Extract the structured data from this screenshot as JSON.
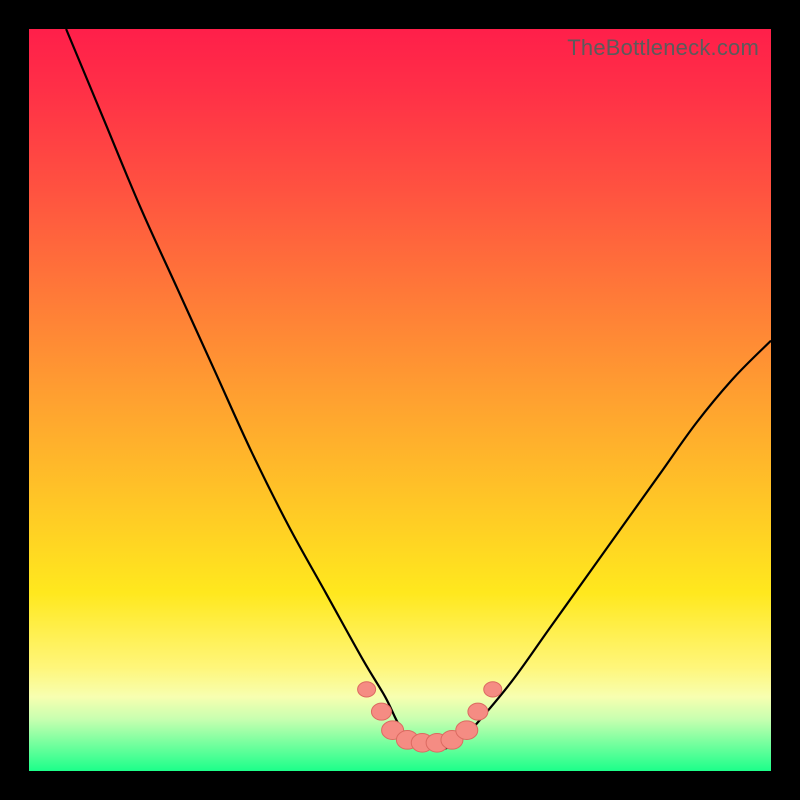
{
  "watermark": "TheBottleneck.com",
  "chart_data": {
    "type": "line",
    "title": "",
    "xlabel": "",
    "ylabel": "",
    "xlim": [
      0,
      100
    ],
    "ylim": [
      0,
      100
    ],
    "series": [
      {
        "name": "bottleneck-curve",
        "x": [
          5,
          10,
          15,
          20,
          25,
          30,
          35,
          40,
          45,
          48,
          50,
          52,
          54,
          56,
          58,
          60,
          65,
          70,
          75,
          80,
          85,
          90,
          95,
          100
        ],
        "y": [
          100,
          88,
          76,
          65,
          54,
          43,
          33,
          24,
          15,
          10,
          6,
          4,
          3,
          3,
          4,
          6,
          12,
          19,
          26,
          33,
          40,
          47,
          53,
          58
        ]
      }
    ],
    "markers": {
      "name": "highlight-points",
      "x": [
        45.5,
        47.5,
        49,
        51,
        53,
        55,
        57,
        59,
        60.5,
        62.5
      ],
      "y": [
        11,
        8,
        5.5,
        4.2,
        3.8,
        3.8,
        4.2,
        5.5,
        8,
        11
      ]
    },
    "gradient_stops": [
      {
        "pos": 0.0,
        "color": "#ff1f4a"
      },
      {
        "pos": 0.5,
        "color": "#ffa130"
      },
      {
        "pos": 0.8,
        "color": "#ffe81e"
      },
      {
        "pos": 1.0,
        "color": "#1cff8a"
      }
    ]
  }
}
